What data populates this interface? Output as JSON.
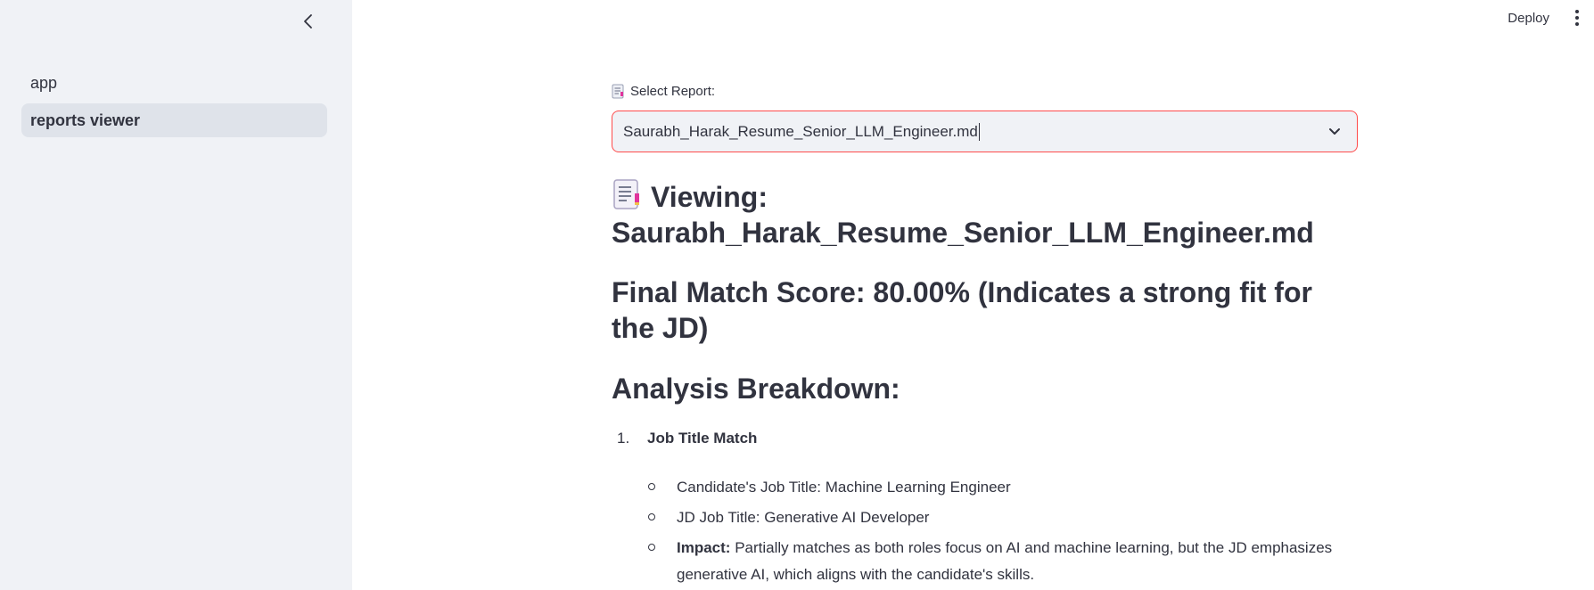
{
  "sidebar": {
    "items": [
      {
        "label": "app",
        "active": false
      },
      {
        "label": "reports viewer",
        "active": true
      }
    ]
  },
  "topbar": {
    "deploy_label": "Deploy"
  },
  "select": {
    "label": "Select Report:",
    "value": "Saurabh_Harak_Resume_Senior_LLM_Engineer.md"
  },
  "viewing": {
    "prefix": "Viewing:",
    "filename": "Saurabh_Harak_Resume_Senior_LLM_Engineer.md"
  },
  "score_heading": "Final Match Score: 80.00% (Indicates a strong fit for the JD)",
  "analysis_heading": "Analysis Breakdown:",
  "list": {
    "number": "1.",
    "title": "Job Title Match",
    "bullets": [
      {
        "text": "Candidate's Job Title: Machine Learning Engineer"
      },
      {
        "text": "JD Job Title: Generative AI Developer"
      },
      {
        "bold": "Impact:",
        "text": " Partially matches as both roles focus on AI and machine learning, but the JD emphasizes generative AI, which aligns with the candidate's skills."
      }
    ]
  },
  "colors": {
    "accent": "#ff4b4b",
    "sidebar_bg": "#f0f2f6",
    "text": "#31333f"
  }
}
